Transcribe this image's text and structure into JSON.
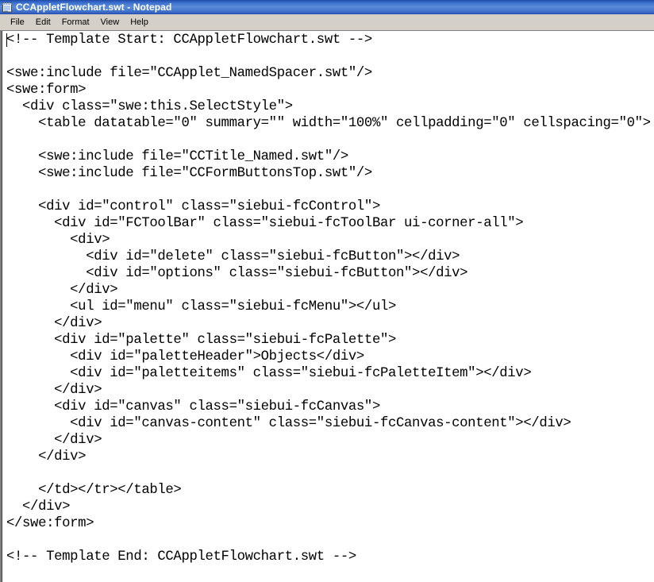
{
  "window": {
    "title": "CCAppletFlowchart.swt - Notepad",
    "icon": "notepad-icon"
  },
  "menubar": {
    "items": [
      {
        "label": "File"
      },
      {
        "label": "Edit"
      },
      {
        "label": "Format"
      },
      {
        "label": "View"
      },
      {
        "label": "Help"
      }
    ]
  },
  "editor": {
    "content": "<!-- Template Start: CCAppletFlowchart.swt -->\n\n<swe:include file=\"CCApplet_NamedSpacer.swt\"/>\n<swe:form>\n  <div class=\"swe:this.SelectStyle\">\n    <table datatable=\"0\" summary=\"\" width=\"100%\" cellpadding=\"0\" cellspacing=\"0\">\n\n    <swe:include file=\"CCTitle_Named.swt\"/>\n    <swe:include file=\"CCFormButtonsTop.swt\"/>\n\n    <div id=\"control\" class=\"siebui-fcControl\">\n      <div id=\"FCToolBar\" class=\"siebui-fcToolBar ui-corner-all\">\n        <div>\n          <div id=\"delete\" class=\"siebui-fcButton\"></div>\n          <div id=\"options\" class=\"siebui-fcButton\"></div>\n        </div>\n        <ul id=\"menu\" class=\"siebui-fcMenu\"></ul>\n      </div>\n      <div id=\"palette\" class=\"siebui-fcPalette\">\n        <div id=\"paletteHeader\">Objects</div>\n        <div id=\"paletteitems\" class=\"siebui-fcPaletteItem\"></div>\n      </div>\n      <div id=\"canvas\" class=\"siebui-fcCanvas\">\n        <div id=\"canvas-content\" class=\"siebui-fcCanvas-content\"></div>\n      </div>\n    </div>\n\n    </td></tr></table>\n  </div>\n</swe:form>\n\n<!-- Template End: CCAppletFlowchart.swt -->"
  },
  "colors": {
    "titlebar_blue": "#2f5dbb",
    "chrome_gray": "#d4d0c8",
    "text_black": "#000000",
    "editor_background": "#ffffff"
  }
}
